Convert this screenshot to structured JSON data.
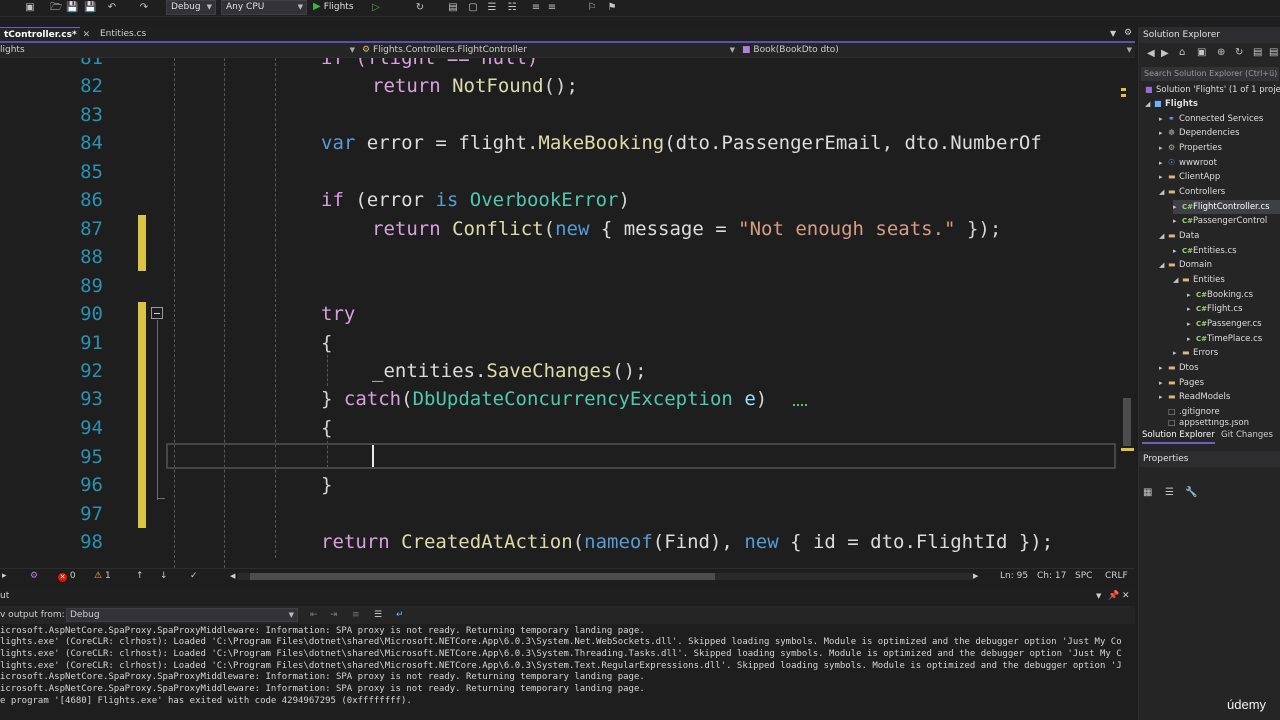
{
  "toolbar": {
    "configuration": "Debug",
    "platform": "Any CPU",
    "run_label": "Flights"
  },
  "tabs": [
    {
      "label": "tController.cs*",
      "active": true
    },
    {
      "label": "Entities.cs",
      "active": false
    }
  ],
  "navbar": {
    "project": "lights",
    "type": "Flights.Controllers.FlightController",
    "member": "Book(BookDto dto)"
  },
  "editor": {
    "line_numbers": [
      "81",
      "82",
      "83",
      "84",
      "85",
      "86",
      "87",
      "88",
      "89",
      "90",
      "91",
      "92",
      "93",
      "94",
      "95",
      "96",
      "97",
      "98"
    ],
    "lines": {
      "l81": "if (flight == null)",
      "l82_kw": "return",
      "l82_m": "NotFound",
      "l82_p": "();",
      "l84_kw": "var",
      "l84_a": "error =",
      "l84_b": "flight.",
      "l84_m": "MakeBooking",
      "l84_c": "(dto.PassengerEmail, dto.NumberOf",
      "l86_kw": "if",
      "l86_a": "(error",
      "l86_is": "is",
      "l86_t": "OverbookError",
      "l86_b": ")",
      "l87_kw": "return",
      "l87_m": "Conflict",
      "l87_a": "(",
      "l87_new": "new",
      "l87_b": "{ message =",
      "l87_s": "\"Not enough seats.\"",
      "l87_c": "});",
      "l90_kw": "try",
      "l91": "{",
      "l92_a": "_entities.",
      "l92_m": "SaveChanges",
      "l92_b": "();",
      "l93_a": "}",
      "l93_kw": "catch",
      "l93_b": "(",
      "l93_t": "DbUpdateConcurrencyException",
      "l93_v": "e",
      "l93_c": ")",
      "l94": "{",
      "l96": "}",
      "l98_kw": "return",
      "l98_m": "CreatedAtAction",
      "l98_a": "(",
      "l98_n": "nameof",
      "l98_b": "(Find),",
      "l98_new": "new",
      "l98_c": "{ id = dto.FlightId });"
    }
  },
  "status": {
    "errors": "0",
    "warnings": "1",
    "line": "Ln: 95",
    "col": "Ch: 17",
    "spc": "SPC",
    "eol": "CRLF"
  },
  "output": {
    "title": "ut",
    "show_from_label": "v output from:",
    "show_from_value": "Debug",
    "lines": [
      "icrosoft.AspNetCore.SpaProxy.SpaProxyMiddleware: Information: SPA proxy is not ready. Returning temporary landing page.",
      "lights.exe' (CoreCLR: clrhost): Loaded 'C:\\Program Files\\dotnet\\shared\\Microsoft.NETCore.App\\6.0.3\\System.Net.WebSockets.dll'. Skipped loading symbols. Module is optimized and the debugger option 'Just My Co",
      "lights.exe' (CoreCLR: clrhost): Loaded 'C:\\Program Files\\dotnet\\shared\\Microsoft.NETCore.App\\6.0.3\\System.Threading.Tasks.dll'. Skipped loading symbols. Module is optimized and the debugger option 'Just My C",
      "lights.exe' (CoreCLR: clrhost): Loaded 'C:\\Program Files\\dotnet\\shared\\Microsoft.NETCore.App\\6.0.3\\System.Text.RegularExpressions.dll'. Skipped loading symbols. Module is optimized and the debugger option 'J",
      "icrosoft.AspNetCore.SpaProxy.SpaProxyMiddleware: Information: SPA proxy is not ready. Returning temporary landing page.",
      "icrosoft.AspNetCore.SpaProxy.SpaProxyMiddleware: Information: SPA proxy is not ready. Returning temporary landing page.",
      "e program '[4680] Flights.exe' has exited with code 4294967295 (0xffffffff)."
    ]
  },
  "solution_explorer": {
    "title": "Solution Explorer",
    "search_placeholder": "Search Solution Explorer (Ctrl+ü)",
    "items": [
      "Solution 'Flights' (1 of 1 proje",
      "Flights",
      "Connected Services",
      "Dependencies",
      "Properties",
      "wwwroot",
      "ClientApp",
      "Controllers",
      "FlightController.cs",
      "PassengerControl",
      "Data",
      "Entities.cs",
      "Domain",
      "Entities",
      "Booking.cs",
      "Flight.cs",
      "Passenger.cs",
      "TimePlace.cs",
      "Errors",
      "Dtos",
      "Pages",
      "ReadModels",
      ".gitignore",
      "appsettings.json"
    ],
    "tab_solution": "Solution Explorer",
    "tab_git": "Git Changes",
    "properties_title": "Properties"
  },
  "watermark": "údemy",
  "colors": {
    "accent": "#6b5fc7",
    "change_bar": "#d9c443",
    "keyword": "#569cd6",
    "control_keyword": "#d8a0df",
    "type": "#4ec9b0",
    "method": "#dcdcaa",
    "string": "#d69d85"
  }
}
